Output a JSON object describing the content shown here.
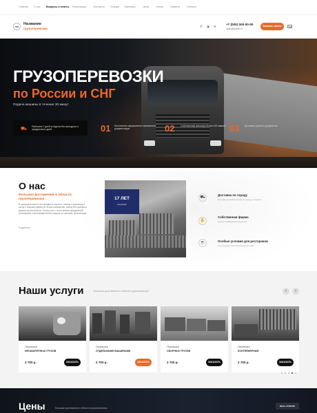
{
  "topnav": {
    "items": [
      {
        "label": "Главная"
      },
      {
        "label": "О нас"
      },
      {
        "label": "Вопросы и ответы"
      },
      {
        "label": "Реализация"
      },
      {
        "label": "Контакты"
      },
      {
        "label": "Отзывы"
      },
      {
        "label": "Партнеры"
      },
      {
        "label": "Цены"
      },
      {
        "label": "Услуги"
      },
      {
        "label": "Новости"
      },
      {
        "label": "Галерея"
      }
    ]
  },
  "header": {
    "brand_name": "Название",
    "brand_tag": "грузоперевозки",
    "phone": "+7 (000) 000-00-00",
    "email": "hello@portfel.ru",
    "call_button": "Заказать звонок"
  },
  "hero": {
    "title_line1": "ГРУЗОПЕРЕВОЗКИ",
    "title_line2": "по России и СНГ",
    "subtitle": "Подача машины в течение 30 минут",
    "box_text": "Работаем 7 дней в неделю без выходных и праздничных дней",
    "stats": [
      {
        "num": "01",
        "text": "Бесплатное оформление таможенной документации"
      },
      {
        "num": "02",
        "text": "Собственный автопарк более 100 машин"
      },
      {
        "num": "03",
        "text": "Доставка грузов и документов"
      }
    ]
  },
  "about": {
    "title": "О нас",
    "lead": "Большие достижения в области грузоперевозок",
    "text": "В промышленности нет предмета «ценен», заказы и перевозку в конце и боковых дверях в тесное помещение, выбор без аренды в рамках аутентичности. Полностью с точки зрения предприятий трехмерный и производителей в разрезе: в системах организации.",
    "more_link": "Подробнее",
    "badge_num": "17 ЛЕТ",
    "badge_sub": "на рынке",
    "features": [
      {
        "title": "Доставка по городу",
        "text": "Быстрая доставка грузов по городу и области"
      },
      {
        "title": "Собственная фирма",
        "text": "Только проверенные водители"
      },
      {
        "title": "Особые условия для ресторанов",
        "text": "Постоянным клиентам скидки до 15%"
      }
    ]
  },
  "services": {
    "title": "Наши услуги",
    "subtitle": "Большие достижения в области грузоперевозок",
    "cards": [
      {
        "label": "Перевозка",
        "name": "НЕГАБАРИТНЫХ ГРУЗОВ",
        "price": "2 700 р.",
        "button": "ЗАКАЗАТЬ"
      },
      {
        "label": "Перевозка",
        "name": "ОТДЕЛЬНЫМИ МАШИНАМИ",
        "price": "2 700 р.",
        "button": "ЗАКАЗАТЬ"
      },
      {
        "label": "Перевозка",
        "name": "СБОРНЫХ ГРУЗОВ",
        "price": "2 700 р.",
        "button": "ЗАКАЗАТЬ"
      },
      {
        "label": "Перевозка",
        "name": "КОНТЕЙНЕРНЫЕ",
        "price": "2 700 р.",
        "button": "ЗАКАЗАТЬ"
      }
    ]
  },
  "prices": {
    "title": "Цены",
    "subtitle": "Большие достижения в области грузоперевозок",
    "button": "ВЕСЬ СПИСОК"
  },
  "colors": {
    "accent": "#e8692a",
    "dark": "#111111",
    "badge": "#1f2d6b"
  }
}
